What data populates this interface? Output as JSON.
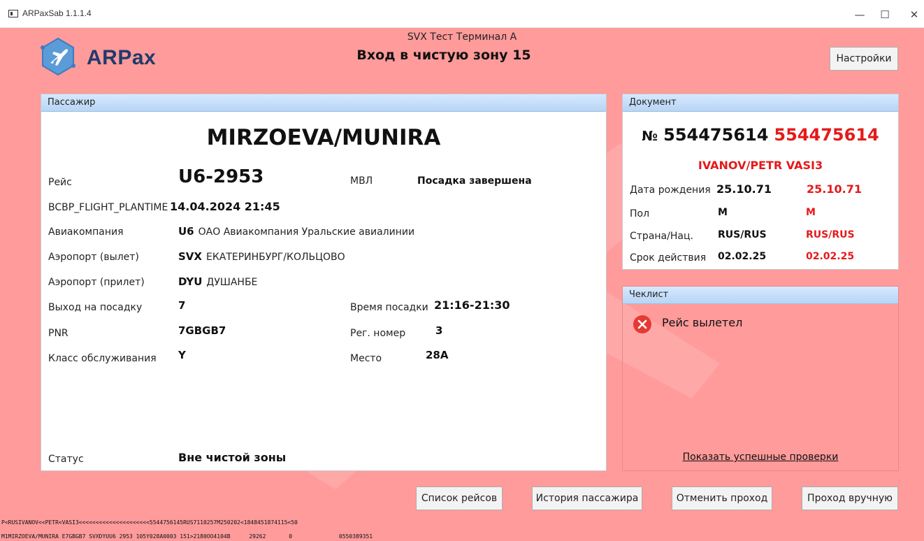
{
  "window": {
    "title": "ARPaxSab 1.1.1.4",
    "minimize": "—",
    "maximize": "☐",
    "close": "✕"
  },
  "header": {
    "logo_text": "ARPax",
    "terminal": "SVX Тест Терминал А",
    "zone": "Вход в чистую зону 15",
    "settings_label": "Настройки"
  },
  "passenger": {
    "panel_title": "Пассажир",
    "name": "MIRZOEVA/MUNIRA",
    "flight_label": "Рейс",
    "flight_value": "U6-2953",
    "mvl_label": "МВЛ",
    "boarding_status": "Посадка завершена",
    "plantime_label": "BCBP_FLIGHT_PLANTIME",
    "plantime_value": "14.04.2024 21:45",
    "airline_label": "Авиакомпания",
    "airline_code": "U6",
    "airline_name": "ОАО Авиакомпания Уральские авиалинии",
    "dep_label": "Аэропорт (вылет)",
    "dep_code": "SVX",
    "dep_name": "ЕКАТЕРИНБУРГ/КОЛЬЦОВО",
    "arr_label": "Аэропорт (прилет)",
    "arr_code": "DYU",
    "arr_name": "ДУШАНБЕ",
    "gate_label": "Выход на посадку",
    "gate_value": "7",
    "boarding_time_label": "Время посадки",
    "boarding_time_value": "21:16-21:30",
    "pnr_label": "PNR",
    "pnr_value": "7GBGB7",
    "reg_label": "Рег. номер",
    "reg_value": "3",
    "class_label": "Класс обслуживания",
    "class_value": "Y",
    "seat_label": "Место",
    "seat_value": "28A",
    "status_label": "Статус",
    "status_value": "Вне чистой зоны"
  },
  "document": {
    "panel_title": "Документ",
    "number_prefix": "№",
    "number_1": "554475614",
    "number_2": "554475614",
    "name": "IVANOV/PETR VASI3",
    "rows": [
      {
        "label": "Дата рождения",
        "v1": "25.10.71",
        "v2": "25.10.71"
      },
      {
        "label": "Пол",
        "v1": "M",
        "v2": "M"
      },
      {
        "label": "Страна/Нац.",
        "v1": "RUS/RUS",
        "v2": "RUS/RUS"
      },
      {
        "label": "Срок действия",
        "v1": "02.02.25",
        "v2": "02.02.25"
      }
    ]
  },
  "checklist": {
    "panel_title": "Чеклист",
    "items": [
      {
        "text": "Рейс вылетел",
        "status": "fail"
      }
    ],
    "show_success_link": "Показать успешные проверки"
  },
  "actions": {
    "flights": "Список рейсов",
    "history": "История пассажира",
    "cancel": "Отменить проход",
    "manual": "Проход вручную"
  },
  "mrz": {
    "line1": "P<RUSIVANOV<<PETR<VASI3<<<<<<<<<<<<<<<<<<<<<5544756145RUS7110257M250202<1848451874115<50",
    "line2_a": "M1MIRZOEVA/MUNIRA    E7GBGB7 SVXDYUU6 2953 105Y028A0003 151>2180OO4104B",
    "line2_b": "29262",
    "line2_c": "0",
    "line2_d": "0550389351"
  },
  "colors": {
    "background_alert": "#ff9b9b",
    "accent_red": "#e41a1a",
    "header_blue": "#b7d5f5",
    "logo_blue": "#1f3b6b"
  }
}
